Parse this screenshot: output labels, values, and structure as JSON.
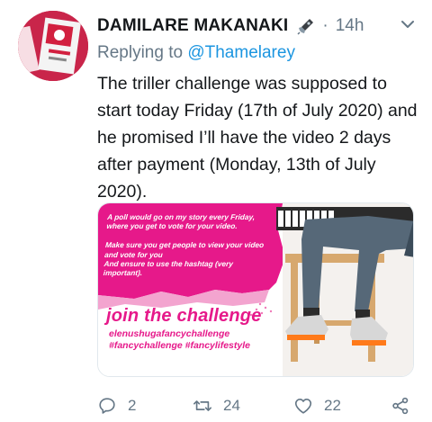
{
  "tweet": {
    "author_name": "DAMILARE MAKANAKI",
    "dot": "·",
    "time": "14h",
    "replying_prefix": "Replying to ",
    "replying_handle": "@Thamelarey",
    "text": "The triller challenge was supposed to start today Friday (17th of July 2020) and he promised I’ll have the video 2 days after payment (Monday, 13th of July 2020)."
  },
  "avatar": {
    "icon": "profile-avatar",
    "color": "#c9254a"
  },
  "card": {
    "info_text": "A poll would go on my story every Friday, where you get to vote for your video.\n\nMake sure you get people to view your video and vote for you\nAnd ensure to use the hashtag (very important).",
    "headline": "join the challenge",
    "hashtag_line1": "elenushugafancychallenge",
    "hashtag_line2": "#fancychallenge #fancylifestyle",
    "accent_color": "#e6198a"
  },
  "actions": {
    "reply_count": "2",
    "retweet_count": "24",
    "like_count": "22",
    "icons": [
      "reply-icon",
      "retweet-icon",
      "like-icon",
      "share-icon"
    ]
  },
  "colors": {
    "secondary_text": "#657786",
    "link": "#1b95e0",
    "primary_text": "#14171a"
  }
}
